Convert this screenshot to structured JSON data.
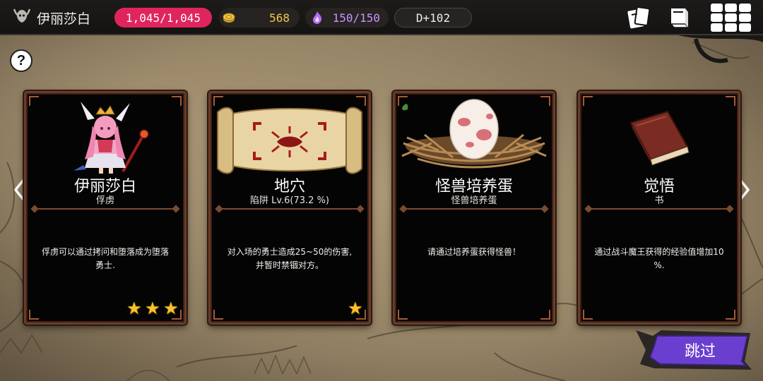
{
  "header": {
    "player_name": "伊丽莎白",
    "hp": "1,045/1,045",
    "gold": "568",
    "mana": "150/150",
    "day": "D+102"
  },
  "help": {
    "label": "?"
  },
  "cards": [
    {
      "title": "伊丽莎白",
      "subtitle": "俘虏",
      "description": "俘虏可以通过拷问和堕落成为堕落勇士.",
      "stars": 3
    },
    {
      "title": "地穴",
      "subtitle": "陷阱 Lv.6(73.2 %)",
      "description": "对入场的勇士造成25~50的伤害,并暂时禁锢对方。",
      "stars": 1
    },
    {
      "title": "怪兽培养蛋",
      "subtitle": "怪兽培养蛋",
      "description": "请通过培养蛋获得怪兽！",
      "stars": 0
    },
    {
      "title": "觉悟",
      "subtitle": "书",
      "description": "通过战斗魔王获得的经验值增加10 %.",
      "stars": 0
    }
  ],
  "skip_button": {
    "label": "跳过"
  },
  "colors": {
    "hp": "#e0245e",
    "gold": "#f2c74a",
    "mana": "#c995ff",
    "card_border": "#6b3b27",
    "skip": "#6a3fd0",
    "star": "#f6c32e"
  }
}
